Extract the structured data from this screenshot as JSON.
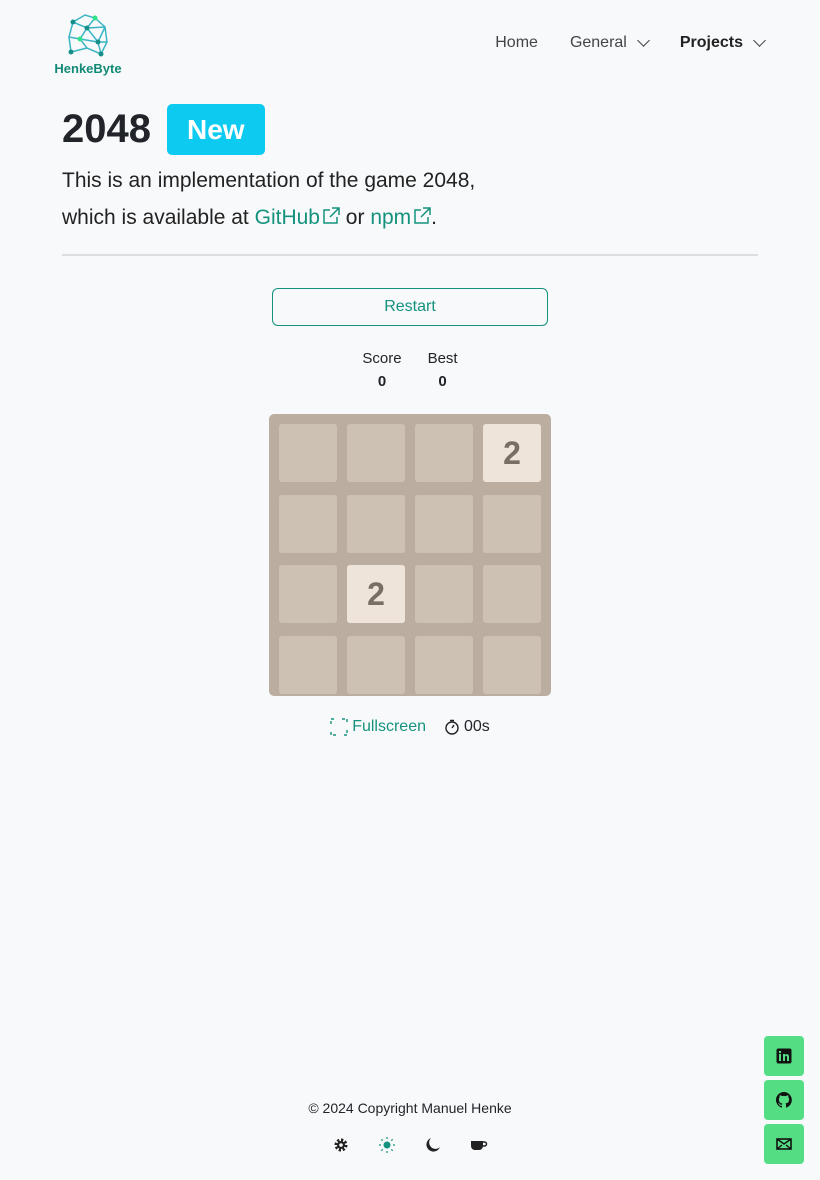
{
  "brand": {
    "name": "HenkeByte"
  },
  "nav": {
    "items": [
      {
        "label": "Home"
      },
      {
        "label": "General"
      },
      {
        "label": "Projects"
      }
    ]
  },
  "page": {
    "title": "2048",
    "badge": "New",
    "desc_line1": "This is an implementation of the game 2048,",
    "desc_pre": "which is available at ",
    "link_github": "GitHub",
    "desc_mid": " or ",
    "link_npm": "npm",
    "desc_end": "."
  },
  "game": {
    "restart_label": "Restart",
    "score_label": "Score",
    "score": "0",
    "best_label": "Best",
    "best": "0",
    "board": [
      [
        "",
        "",
        "",
        "2"
      ],
      [
        "",
        "",
        "",
        ""
      ],
      [
        "",
        "2",
        "",
        ""
      ],
      [
        "",
        "",
        "",
        ""
      ]
    ],
    "fullscreen_label": "Fullscreen",
    "timer": "00s"
  },
  "footer": {
    "copyright": "© 2024 Copyright Manuel Henke"
  },
  "colors": {
    "accent": "#14927d",
    "badge": "#0dcaf0",
    "social": "#55dd84",
    "board": "#bbada0",
    "cell": "#cdc1b4",
    "tile2": "#eee4da"
  }
}
